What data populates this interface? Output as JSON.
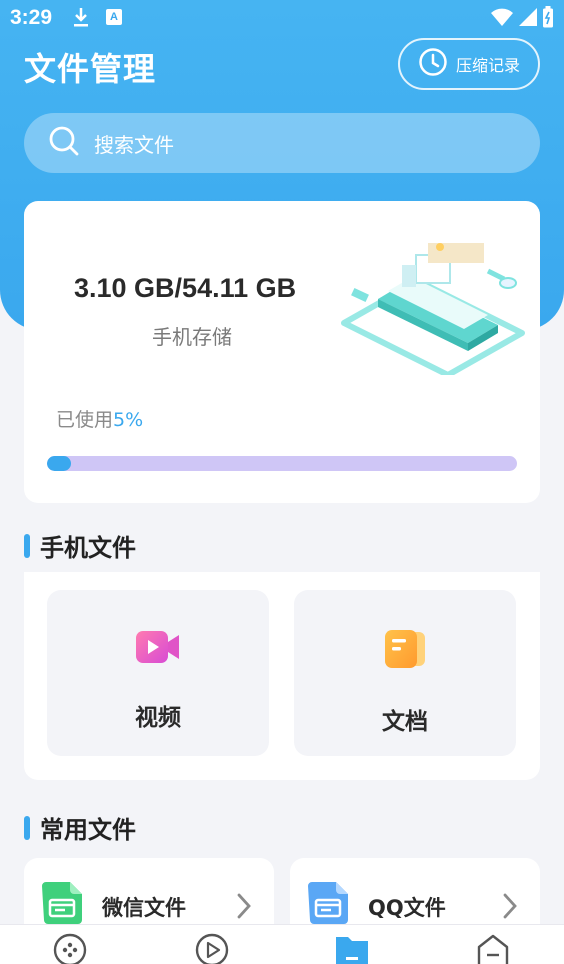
{
  "status_bar": {
    "time": "3:29",
    "a_badge": "A"
  },
  "header": {
    "title": "文件管理",
    "history_label": "压缩记录"
  },
  "search": {
    "placeholder": "搜索文件"
  },
  "storage": {
    "size_text": "3.10 GB/54.11 GB",
    "label": "手机存储",
    "used_prefix": "已使用",
    "used_percent_text": "5%",
    "used_fraction": 0.05
  },
  "sections": {
    "phone_files": "手机文件",
    "common_files": "常用文件"
  },
  "phone_files": [
    {
      "label": "视频",
      "icon": "video-icon"
    },
    {
      "label": "文档",
      "icon": "document-icon"
    }
  ],
  "common_files": [
    {
      "label": "微信文件",
      "icon": "wechat-file-icon"
    },
    {
      "label": "QQ文件",
      "icon": "qq-file-icon"
    }
  ],
  "bottom_nav": [
    {
      "icon": "game-icon"
    },
    {
      "icon": "play-icon"
    },
    {
      "icon": "folder-icon",
      "active": true
    },
    {
      "icon": "home-icon"
    }
  ],
  "colors": {
    "accent": "#3aa8ee",
    "progress_track": "#cfc6f6"
  }
}
